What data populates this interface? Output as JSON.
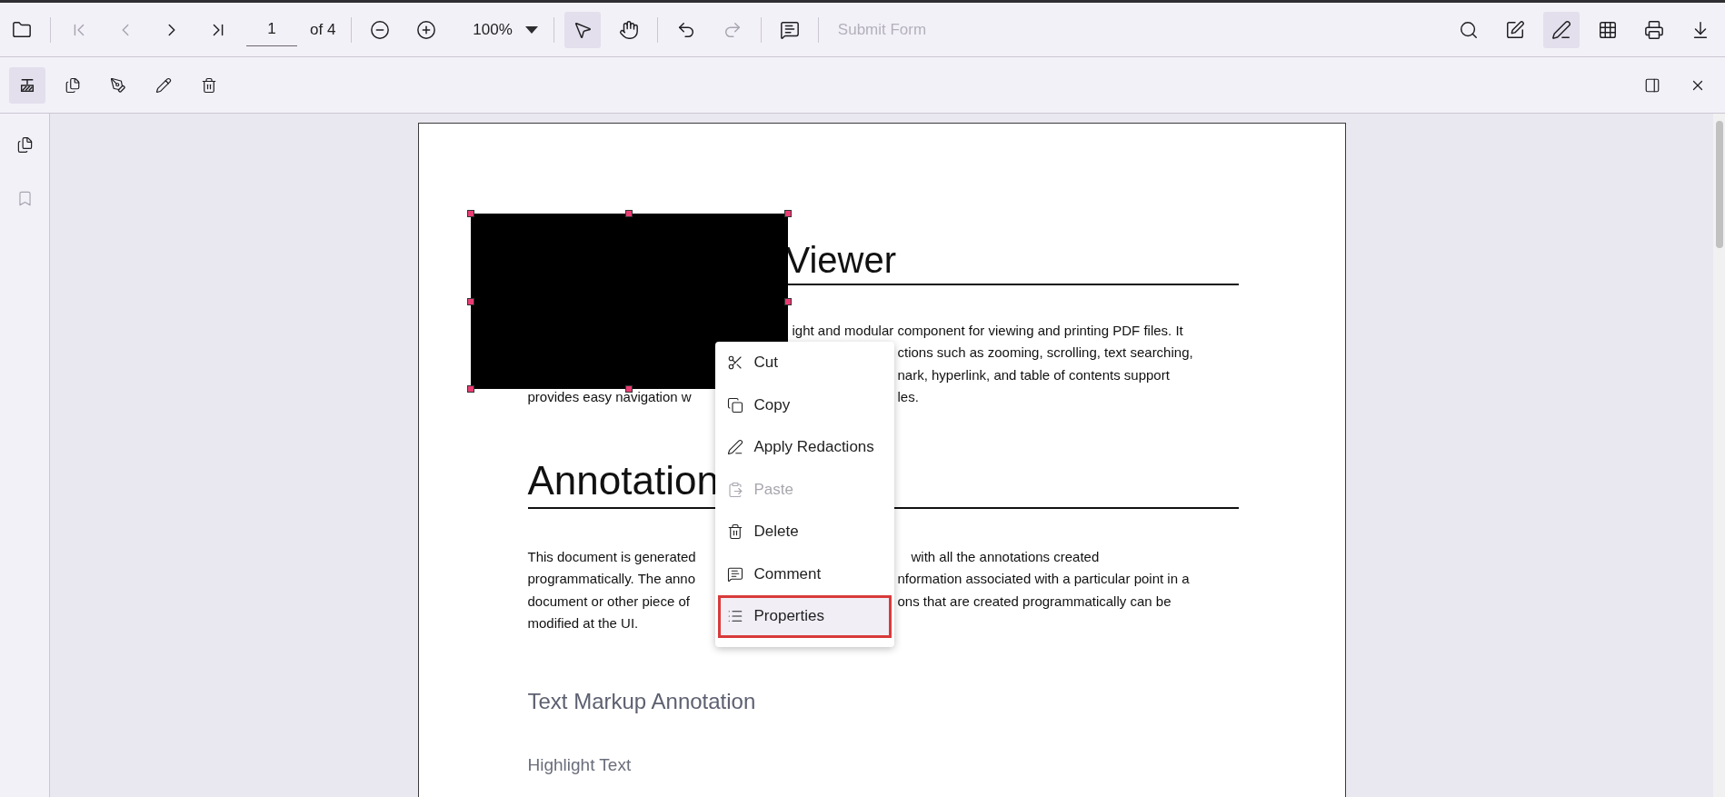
{
  "main_toolbar": {
    "left": [
      {
        "kind": "button",
        "disabled": false,
        "selected": false
      },
      {
        "kind": "separator"
      },
      {
        "kind": "button",
        "disabled": true,
        "selected": false
      },
      {
        "kind": "button",
        "disabled": true,
        "selected": false
      },
      {
        "kind": "button",
        "disabled": false,
        "selected": false
      },
      {
        "kind": "button",
        "disabled": false,
        "selected": false
      },
      {
        "kind": "page-input",
        "value": "1"
      },
      {
        "kind": "label",
        "text": "of 4"
      },
      {
        "kind": "separator"
      },
      {
        "kind": "button",
        "disabled": false,
        "selected": false
      },
      {
        "kind": "button",
        "disabled": false,
        "selected": false
      },
      {
        "kind": "zoom",
        "value": "100%"
      },
      {
        "kind": "separator"
      },
      {
        "kind": "button",
        "disabled": false,
        "selected": true
      },
      {
        "kind": "button",
        "disabled": false,
        "selected": false
      },
      {
        "kind": "separator"
      },
      {
        "kind": "button",
        "disabled": false,
        "selected": false
      },
      {
        "kind": "button",
        "disabled": true,
        "selected": false
      },
      {
        "kind": "separator"
      },
      {
        "kind": "button",
        "disabled": false,
        "selected": false
      },
      {
        "kind": "separator"
      },
      {
        "kind": "text-button",
        "label": "Submit Form",
        "disabled": true
      }
    ],
    "right": [
      {
        "selected": false
      },
      {
        "selected": false
      },
      {
        "selected": true
      },
      {
        "selected": false
      },
      {
        "selected": false
      },
      {
        "selected": false
      }
    ]
  },
  "redaction_toolbar": {
    "left": [
      {
        "selected": true
      },
      {
        "selected": false
      },
      {
        "selected": false
      },
      {
        "selected": false
      },
      {
        "selected": false
      }
    ],
    "right": [
      {
        "selected": false
      },
      {
        "selected": false
      }
    ]
  },
  "sidebar": [
    {
      "disabled": false
    },
    {
      "disabled": true
    }
  ],
  "document": {
    "redaction_box": {
      "selected": true
    },
    "title": "Viewer",
    "paragraph_1": [
      {
        "right": "ight and modular component for viewing and printing PDF files. It"
      },
      {
        "right": "ctions such as zooming, scrolling, text searching,"
      },
      {
        "right": "nark, hyperlink, and table of contents support"
      },
      {
        "left": "provides easy navigation w",
        "right": "les."
      }
    ],
    "heading_2": "Annotation",
    "paragraph_2": [
      {
        "left": "This document is generated",
        "right": "with all the annotations created"
      },
      {
        "left": "programmatically. The anno",
        "right": "nformation associated with a particular point in a"
      },
      {
        "left": "document or other piece of",
        "right": "ons that are created programmatically can be"
      },
      {
        "left": "modified at the UI."
      }
    ],
    "heading_3": "Text Markup Annotation",
    "heading_4": "Highlight Text"
  },
  "context_menu": [
    {
      "label": "Cut",
      "disabled": false,
      "selected": false
    },
    {
      "label": "Copy",
      "disabled": false,
      "selected": false
    },
    {
      "label": "Apply Redactions",
      "disabled": false,
      "selected": false
    },
    {
      "label": "Paste",
      "disabled": true,
      "selected": false
    },
    {
      "label": "Delete",
      "disabled": false,
      "selected": false
    },
    {
      "label": "Comment",
      "disabled": false,
      "selected": false
    },
    {
      "label": "Properties",
      "disabled": false,
      "selected": true
    }
  ]
}
